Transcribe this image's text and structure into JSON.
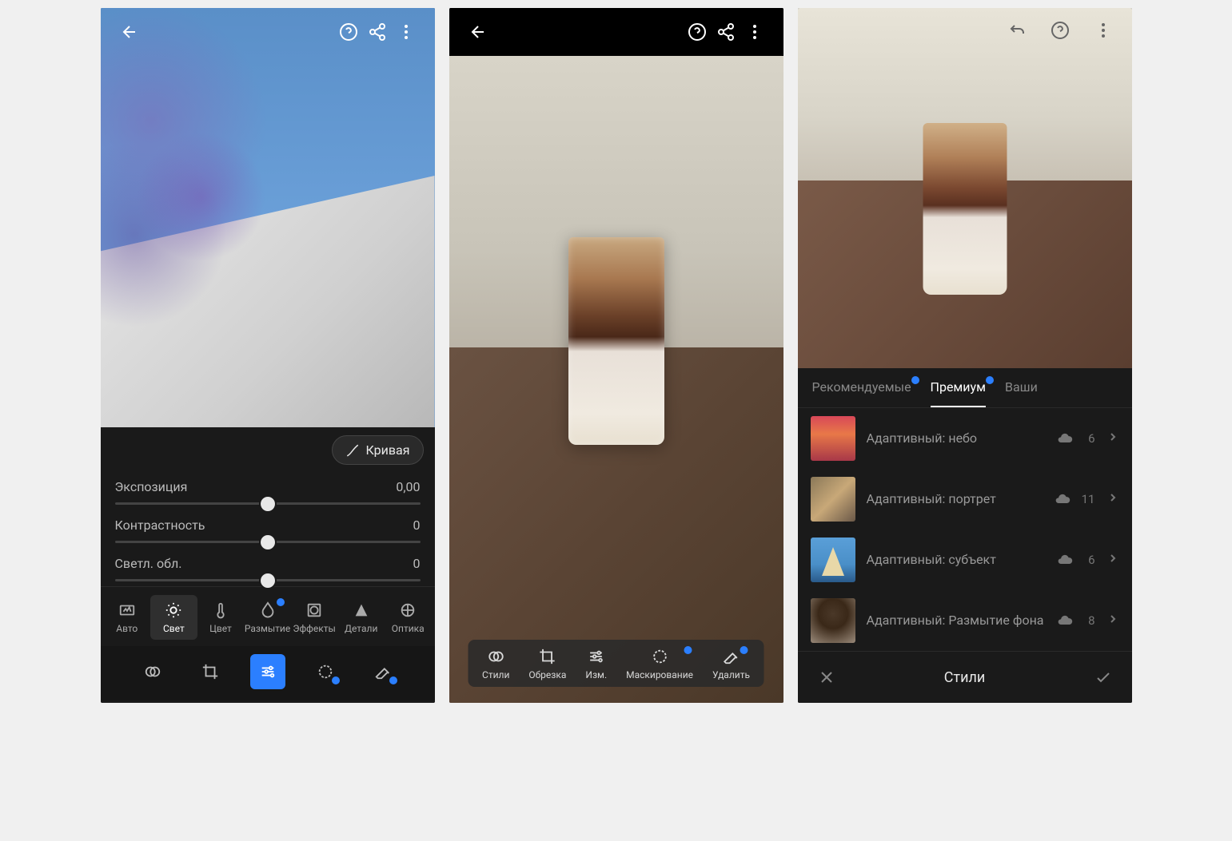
{
  "screen1": {
    "curves_label": "Кривая",
    "sliders": [
      {
        "label": "Экспозиция",
        "value": "0,00"
      },
      {
        "label": "Контрастность",
        "value": "0"
      },
      {
        "label": "Светл. обл.",
        "value": "0"
      }
    ],
    "tools": [
      {
        "label": "Авто"
      },
      {
        "label": "Свет"
      },
      {
        "label": "Цвет"
      },
      {
        "label": "Размытие"
      },
      {
        "label": "Эффекты"
      },
      {
        "label": "Детали"
      },
      {
        "label": "Оптика"
      }
    ]
  },
  "screen2": {
    "tools": [
      {
        "label": "Стили"
      },
      {
        "label": "Обрезка"
      },
      {
        "label": "Изм."
      },
      {
        "label": "Маскирование"
      },
      {
        "label": "Удалить"
      }
    ]
  },
  "screen3": {
    "tabs": [
      {
        "label": "Рекомендуемые"
      },
      {
        "label": "Премиум"
      },
      {
        "label": "Ваши"
      }
    ],
    "items": [
      {
        "label": "Адаптивный: небо",
        "count": "6"
      },
      {
        "label": "Адаптивный: портрет",
        "count": "11"
      },
      {
        "label": "Адаптивный: субъект",
        "count": "6"
      },
      {
        "label": "Адаптивный: Размытие фона",
        "count": "8"
      }
    ],
    "footer_title": "Стили"
  }
}
